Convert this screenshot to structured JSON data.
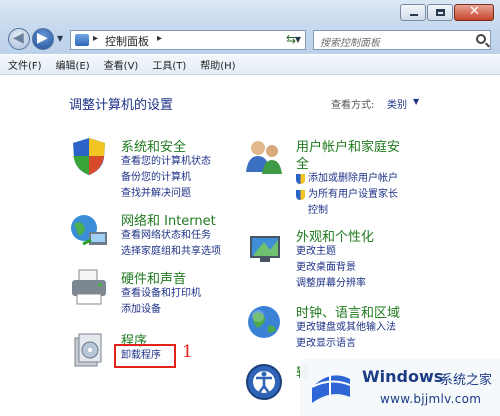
{
  "window": {
    "address": {
      "breadcrumb": "控制面板",
      "separator": "▸"
    },
    "search": {
      "placeholder": "搜索控制面板"
    }
  },
  "menu": [
    "文件(F)",
    "编辑(E)",
    "查看(V)",
    "工具(T)",
    "帮助(H)"
  ],
  "page": {
    "title": "调整计算机的设置",
    "view_by_label": "查看方式:",
    "view_by_value": "类别"
  },
  "categories_left": [
    {
      "title": "系统和安全",
      "icon": "shield-icon",
      "links": [
        "查看您的计算机状态",
        "备份您的计算机",
        "查找并解决问题"
      ]
    },
    {
      "title": "网络和 Internet",
      "icon": "network-icon",
      "links": [
        "查看网络状态和任务",
        "选择家庭组和共享选项"
      ]
    },
    {
      "title": "硬件和声音",
      "icon": "printer-icon",
      "links": [
        "查看设备和打印机",
        "添加设备"
      ]
    },
    {
      "title": "程序",
      "icon": "programs-icon",
      "links": [
        "卸载程序"
      ]
    }
  ],
  "categories_right": [
    {
      "title": "用户帐户和家庭安",
      "title2": "全",
      "icon": "users-icon",
      "links": [
        "添加或删除用户帐户",
        "为所有用户设置家长",
        "控制"
      ]
    },
    {
      "title": "外观和个性化",
      "icon": "appearance-icon",
      "links": [
        "更改主题",
        "更改桌面背景",
        "调整屏幕分辨率"
      ]
    },
    {
      "title": "时钟、语言和区域",
      "icon": "globe-icon",
      "links": [
        "更改键盘或其他输入法",
        "更改显示语言"
      ]
    },
    {
      "title": "轻",
      "icon": "accessibility-icon",
      "links": []
    }
  ],
  "annotation": {
    "number": "1"
  },
  "watermark": {
    "title": "Windows",
    "subtitle": "系统之家",
    "url": "www.bjjmlv.com"
  }
}
